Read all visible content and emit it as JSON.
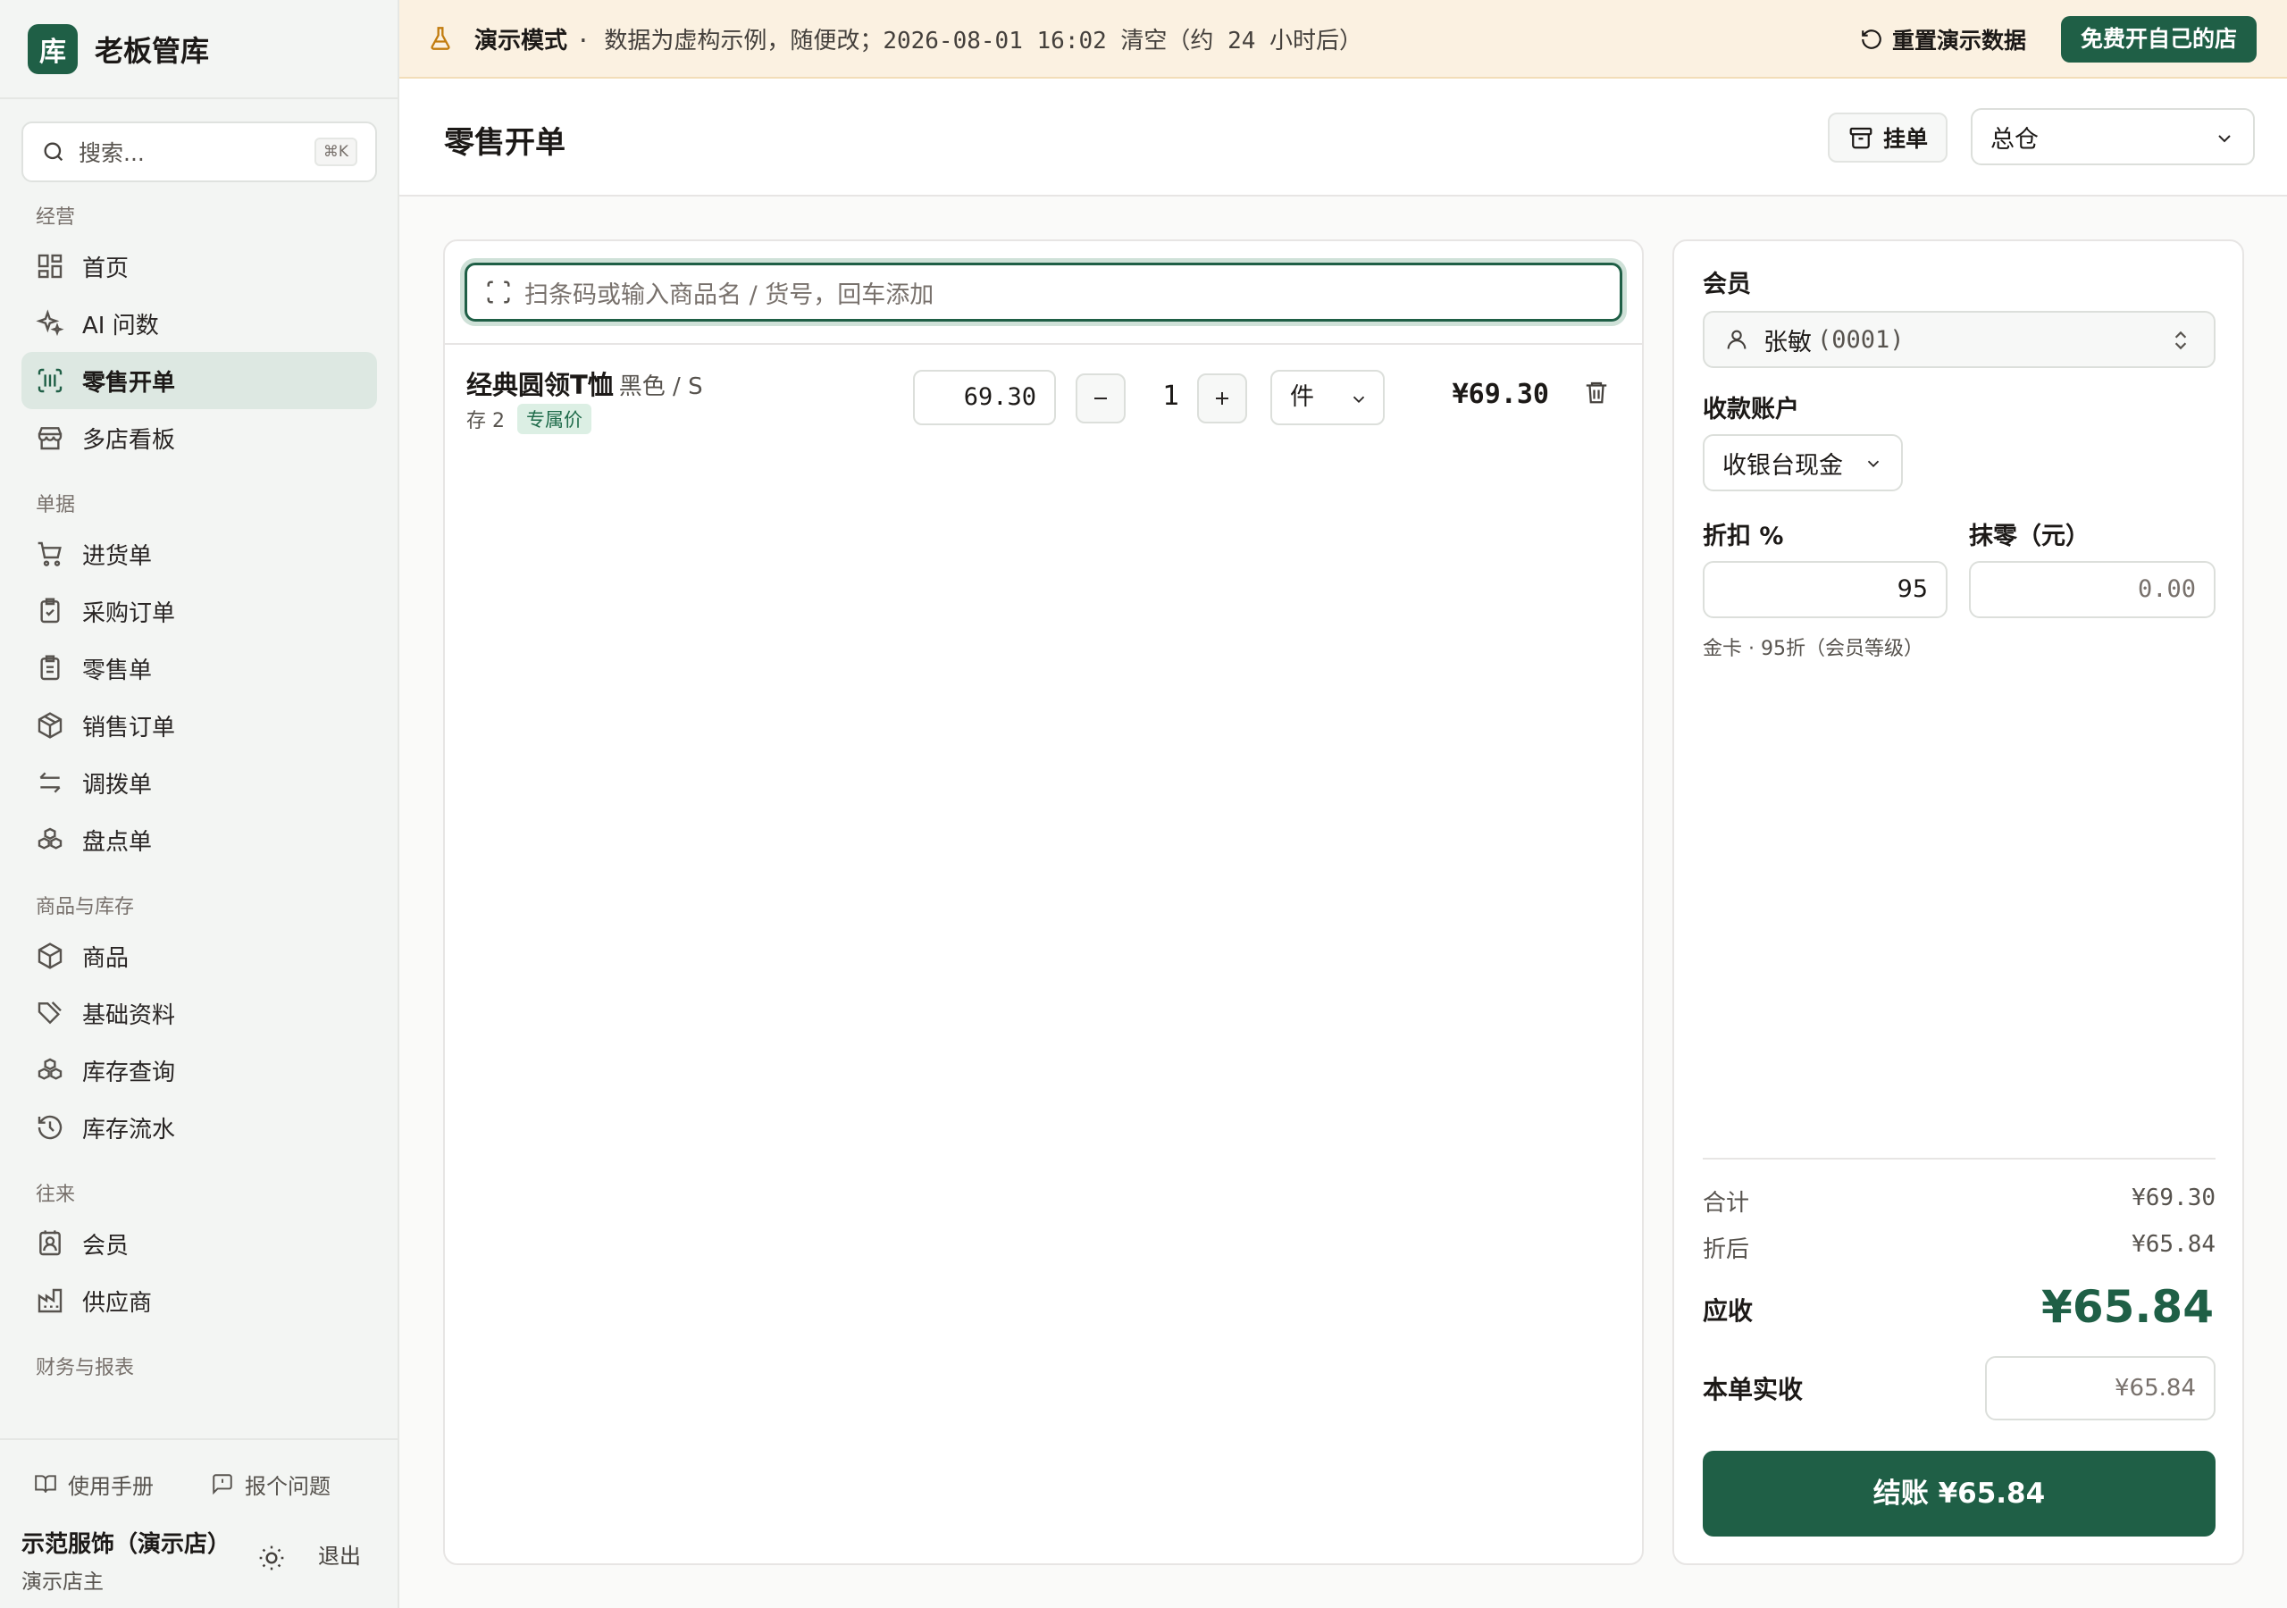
{
  "brand": {
    "logo_char": "库",
    "name": "老板管库"
  },
  "search": {
    "placeholder": "搜索...",
    "shortcut": "⌘K"
  },
  "nav": {
    "sections": [
      {
        "title": "经营",
        "items": [
          "首页",
          "AI 问数",
          "零售开单",
          "多店看板"
        ]
      },
      {
        "title": "单据",
        "items": [
          "进货单",
          "采购订单",
          "零售单",
          "销售订单",
          "调拨单",
          "盘点单"
        ]
      },
      {
        "title": "商品与库存",
        "items": [
          "商品",
          "基础资料",
          "库存查询",
          "库存流水"
        ]
      },
      {
        "title": "往来",
        "items": [
          "会员",
          "供应商"
        ]
      },
      {
        "title": "财务与报表",
        "items": []
      }
    ],
    "active": "零售开单"
  },
  "footer": {
    "manual": "使用手册",
    "report": "报个问题",
    "store_name": "示范服饰（演示店）",
    "role": "演示店主",
    "logout": "退出"
  },
  "banner": {
    "mode": "演示模式",
    "message": "· 数据为虚构示例，随便改；2026-08-01 16:02 清空（约 24 小时后）",
    "reset": "重置演示数据",
    "cta": "免费开自己的店"
  },
  "header": {
    "title": "零售开单",
    "hold": "挂单",
    "warehouse": "总仓"
  },
  "scan": {
    "placeholder": "扫条码或输入商品名 / 货号，回车添加"
  },
  "line_items": [
    {
      "name": "经典圆领T恤",
      "variant": "黑色 / S",
      "stock": "存 2",
      "tag": "专属价",
      "price": "69.30",
      "qty": "1",
      "unit": "件",
      "subtotal": "¥69.30"
    }
  ],
  "checkout": {
    "member_label": "会员",
    "member_name": "张敏",
    "member_code": "(0001)",
    "account_label": "收款账户",
    "account": "收银台现金",
    "discount_label": "折扣 %",
    "discount": "95",
    "rounding_label": "抹零（元）",
    "rounding": "0.00",
    "hint": "金卡 · 95折（会员等级）",
    "total_label": "合计",
    "total": "¥69.30",
    "after_label": "折后",
    "after": "¥65.84",
    "due_label": "应收",
    "due": "¥65.84",
    "paid_label": "本单实收",
    "paid": "¥65.84",
    "button": "结账 ¥65.84"
  },
  "colors": {
    "accent": "#1f5f46",
    "banner_bg": "#fbf1e1",
    "active_nav": "#dde8e2"
  }
}
